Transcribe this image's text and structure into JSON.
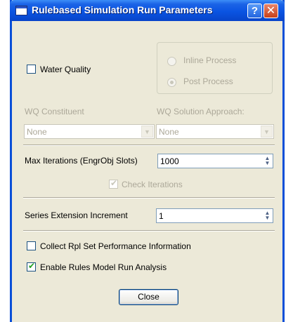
{
  "window": {
    "title": "Rulebased Simulation Run Parameters",
    "help_label": "?",
    "close_label": "✕"
  },
  "water_quality": {
    "label": "Water Quality",
    "checked": false
  },
  "process_group": {
    "options": [
      {
        "label": "Inline Process",
        "selected": false
      },
      {
        "label": "Post Process",
        "selected": true
      }
    ]
  },
  "wq_constituent": {
    "label": "WQ Constituent",
    "value": "None"
  },
  "wq_solution": {
    "label": "WQ Solution Approach:",
    "value": "None"
  },
  "max_iterations": {
    "label": "Max Iterations  (EngrObj Slots)",
    "value": "1000"
  },
  "check_iterations": {
    "label": "Check Iterations",
    "checked": true
  },
  "series_extension": {
    "label": "Series Extension Increment",
    "value": "1"
  },
  "collect_rpl": {
    "label": "Collect Rpl Set Performance Information",
    "checked": false
  },
  "enable_rules": {
    "label": "Enable Rules Model Run Analysis",
    "checked": true
  },
  "close_button": {
    "label": "Close"
  }
}
